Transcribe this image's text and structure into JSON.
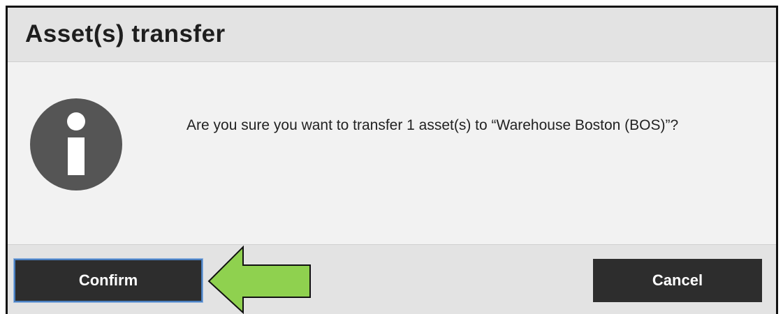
{
  "dialog": {
    "title": "Asset(s) transfer",
    "message": "Are you sure you want to transfer 1 asset(s) to “Warehouse Boston (BOS)”?",
    "icon": "info-icon",
    "confirm_label": "Confirm",
    "cancel_label": "Cancel"
  },
  "annotation": {
    "arrow_color": "#8fd14f",
    "points_to": "confirm-button"
  },
  "colors": {
    "button_bg": "#2d2d2d",
    "focus_ring": "#4a7fc0",
    "icon_bg": "#555555"
  }
}
